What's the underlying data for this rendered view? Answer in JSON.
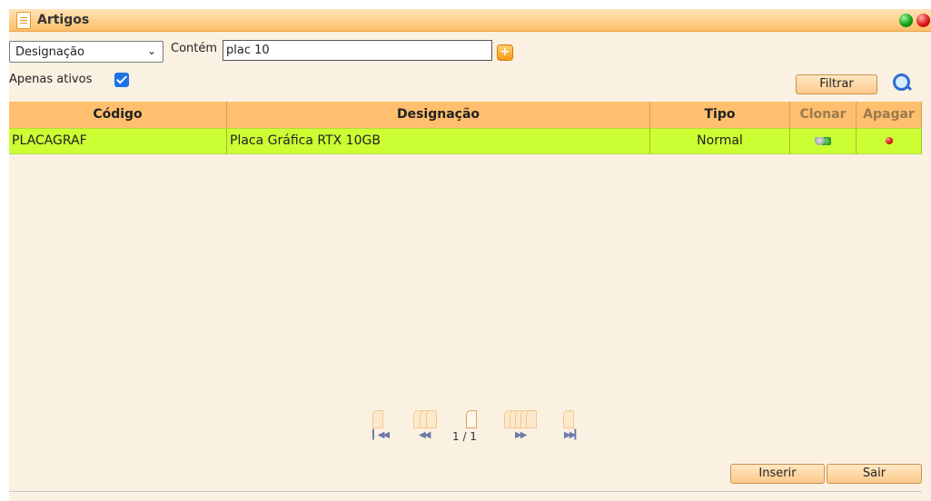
{
  "window": {
    "title": "Artigos"
  },
  "filter": {
    "field_select": "Designação",
    "contains_label": "Contém",
    "search_value": "plac 10",
    "active_only_label": "Apenas ativos",
    "active_only_checked": true,
    "filter_button": "Filtrar"
  },
  "table": {
    "headers": {
      "codigo": "Código",
      "designacao": "Designação",
      "tipo": "Tipo",
      "clonar": "Clonar",
      "apagar": "Apagar"
    },
    "rows": [
      {
        "codigo": "PLACAGRAF",
        "designacao": "Placa Gráfica RTX 10GB",
        "tipo": "Normal"
      }
    ],
    "row_highlight_color": "#ccff33",
    "header_color": "#ffbf6e"
  },
  "pagination": {
    "page_text": "1 / 1"
  },
  "actions": {
    "insert": "Inserir",
    "exit": "Sair"
  },
  "icons": {
    "title": "document-icon",
    "window_green": "green-dot-icon",
    "window_red": "red-dot-icon",
    "add": "plus-icon",
    "search": "magnifier-icon",
    "clone": "clone-icon",
    "delete": "delete-icon"
  }
}
